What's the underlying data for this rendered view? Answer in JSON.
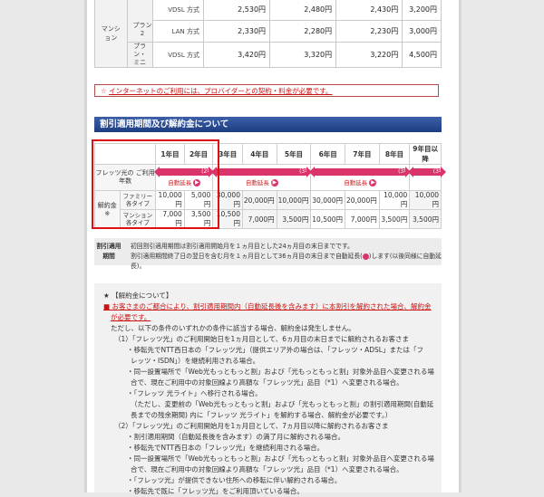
{
  "price_table": {
    "category": "マンション",
    "rows": [
      {
        "plan": "",
        "name": "VDSL 方式",
        "values": [
          "2,530円",
          "2,480円",
          "2,430円",
          "3,200円"
        ]
      },
      {
        "plan": "プラン 2",
        "name": "LAN 方式",
        "values": [
          "2,330円",
          "2,280円",
          "2,230円",
          "3,000円"
        ]
      },
      {
        "plan": "プラン・ミニ",
        "name": "VDSL 方式",
        "values": [
          "3,420円",
          "3,320円",
          "3,220円",
          "4,500円"
        ]
      }
    ]
  },
  "notice": {
    "star": "☆",
    "text": "インターネットのご利用には、プロバイダーとの契約・料金が必要です。"
  },
  "section_title": "割引適用期間及び解約金について",
  "discount": {
    "years": [
      "1年目",
      "2年目",
      "3年目",
      "4年目",
      "5年目",
      "6年目",
      "7年目",
      "8年目",
      "9年目以降"
    ],
    "usage_label": "フレッツ光の ご利用年数",
    "bars": [
      {
        "label": "(2年間)",
        "auto": "自動延長"
      },
      {
        "label": "(3年間)",
        "auto": "自動延長"
      },
      {
        "label": "(3年間)",
        "auto": "自動延長"
      },
      {
        "label": "(3年間)",
        "auto": ""
      }
    ],
    "auto_dot": "▶",
    "fee_label": "解約金※",
    "family_label": "ファミリー 各タイプ",
    "mansion_label": "マンション 各タイプ",
    "family_values": [
      "10,000円",
      "5,000円",
      "30,000円",
      "20,000円",
      "10,000円",
      "30,000円",
      "20,000円",
      "10,000円",
      "10,000円"
    ],
    "mansion_values": [
      "7,000円",
      "3,500円",
      "10,500円",
      "7,000円",
      "3,500円",
      "10,500円",
      "7,000円",
      "3,500円",
      "3,500円"
    ]
  },
  "period_note": {
    "label": "割引適用期間",
    "line1": "初回割引適用期間は割引適用開始月を１ヵ月目とした24ヵ月目の末日までです。",
    "line2a": "割引適用期間終了日の翌日を含む月を１ヵ月目として36ヵ月目の末日まで自動延長(",
    "line2b": ")します(以後同様に自動延長)。"
  },
  "cancel": {
    "l1": "★ 【解約金について】",
    "l2": "■ お客さまのご都合により、割引適用期間内（自動延長後を含みます）に本割引を解約された場合、解約金",
    "l3": "が必要です。",
    "l4": "ただし、以下の条件のいずれかの条件に該当する場合、解約金は発生しません。",
    "l5": "（1）「フレッツ光」のご利用開始日を1ヵ月目として、6ヵ月目の末日までに解約されるお客さま",
    "l6": "・移転先でNTT西日本の「フレッツ光」（提供エリア外の場合は、「フレッツ・ADSL」または「フ",
    "l7": "レッツ・ISDN」）を継続利用される場合。",
    "l8": "・同一設置場所で「Web光もっともっと割」および「光もっともっと割」対象外品目へ変更される場",
    "l9": "合で、現在ご利用中の対象回線より高額な「フレッツ光」品目（*1）へ変更される場合。",
    "l10": "・「フレッツ 光ライト」へ移行される場合。",
    "l11": "（ただし、変更前の「Web光もっともっと割」および「光もっともっと割」の割引適用期間(自動延",
    "l12": "長までの残余期間) 内に「フレッツ 光ライト」を解約する場合、解約金が必要です。）",
    "l13": "（2）「フレッツ光」のご利用開始月を1ヵ月目として、7ヵ月目以降に解約されるお客さま",
    "l14": "・割引適用期間（自動延長後を含みます）の満了月に解約される場合。",
    "l15": "・移転先でNTT西日本の「フレッツ光」を継続利用される場合。",
    "l16": "・同一設置場所で「Web光もっともっと割」および「光もっともっと割」対象外品目へ変更される場",
    "l17": "合で、現在ご利用中の対象回線より高額な「フレッツ光」品目（*1）へ変更される場合。",
    "l18": "・「フレッツ光」が提供できない住所への移転に伴い解約される場合。",
    "l19": "・移転先で既に「フレッツ光」をご利用頂いている場合。"
  }
}
